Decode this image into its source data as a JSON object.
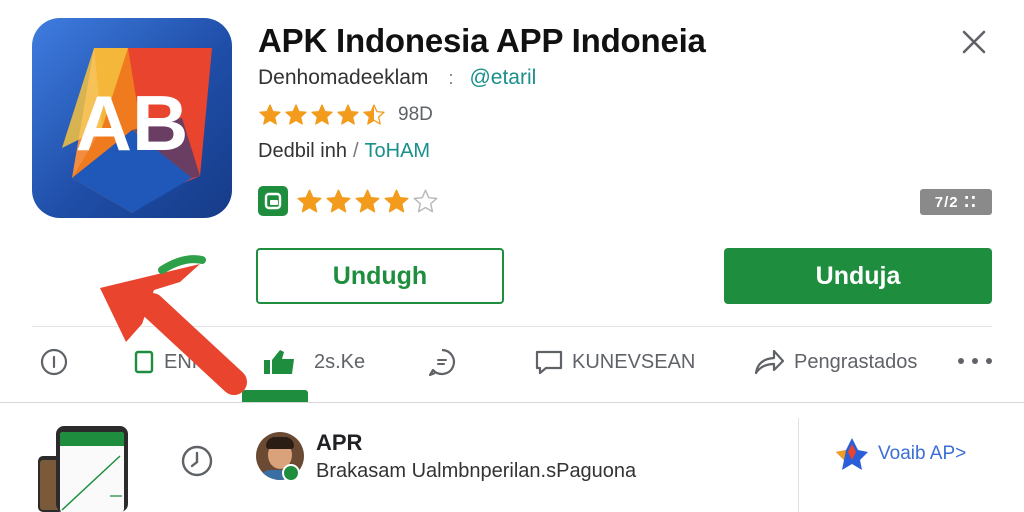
{
  "app": {
    "title": "APK Indonesia APP Indoneia",
    "icon_letters": "AB",
    "developer": "Denhomadeeklam",
    "developer_separator": ":",
    "developer_link": "@etaril",
    "rating_value": 4.5,
    "rating_count": "98D",
    "detail_label": "Dedbil inh",
    "detail_separator": "/",
    "detail_link": "ToHAM",
    "badge_rating": 4,
    "version_badge": "7/2 ⁚⁚"
  },
  "buttons": {
    "secondary_label": "Undugh",
    "primary_label": "Unduja"
  },
  "tabs": [
    {
      "label": "",
      "icon": "info-icon"
    },
    {
      "label": "ENP",
      "icon": "overview-icon"
    },
    {
      "label": "2s.Ke",
      "icon": "thumbs-up-icon",
      "active": true
    },
    {
      "label": "",
      "icon": "chat-icon"
    },
    {
      "label": "KUNEVSEAN",
      "icon": "message-icon"
    },
    {
      "label": "Pengrastados",
      "icon": "share-icon"
    }
  ],
  "review": {
    "author": "APR",
    "text": "Brakasam Ualmbnperilan.sPaguona",
    "aside_link": "Voaib AP>"
  },
  "colors": {
    "accent_green": "#1e8e3e",
    "teal_link": "#1a8f8c",
    "star_orange": "#f29b1c",
    "annotation_red": "#e8442e",
    "link_blue": "#3b6fd6"
  }
}
